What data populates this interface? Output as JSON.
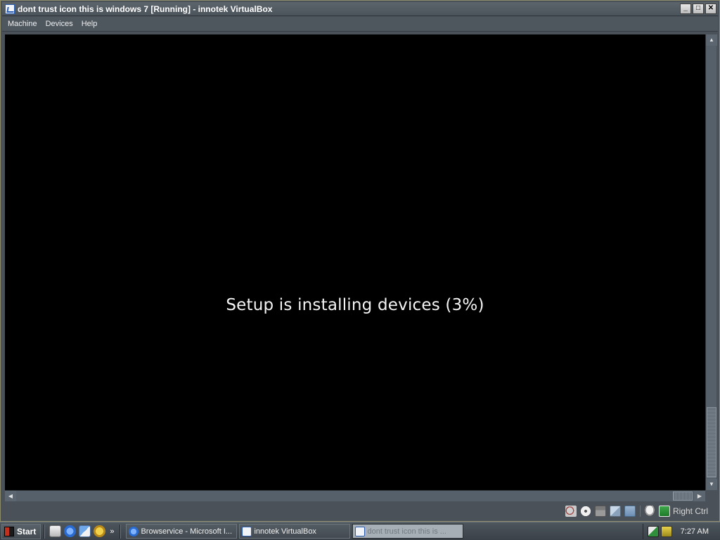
{
  "window": {
    "title": "dont trust icon this is windows 7 [Running] - innotek VirtualBox",
    "controls": {
      "minimize": "_",
      "maximize": "□",
      "close": "✕"
    }
  },
  "menubar": {
    "items": [
      "Machine",
      "Devices",
      "Help"
    ]
  },
  "vm": {
    "status_text": "Setup is installing devices (3%)",
    "progress_percent": 3
  },
  "scrollbars": {
    "up": "▲",
    "down": "▼",
    "left": "◀",
    "right": "▶"
  },
  "statusbar": {
    "icons": [
      "hard-disk-icon",
      "cd-icon",
      "floppy-icon",
      "network-icon",
      "shared-folder-icon",
      "mouse-integration-icon",
      "host-key-icon"
    ],
    "host_key": "Right Ctrl"
  },
  "taskbar": {
    "start_label": "Start",
    "quick_launch": [
      "desktop-icon",
      "ie-icon",
      "outlook-icon",
      "media-icon"
    ],
    "more": "»",
    "tasks": [
      {
        "label": "Browservice - Microsoft I...",
        "icon": "ie-icon",
        "active": false
      },
      {
        "label": "innotek VirtualBox",
        "icon": "virtualbox-icon",
        "active": false
      },
      {
        "label": "dont trust icon this is ...",
        "icon": "virtualbox-icon",
        "active": true
      }
    ],
    "tray_icons": [
      "network-tray-icon",
      "security-tray-icon"
    ],
    "clock": "7:27 AM"
  },
  "colors": {
    "vm_background": "#000000",
    "chrome": "#4a5158",
    "text": "#f4f4f4"
  }
}
